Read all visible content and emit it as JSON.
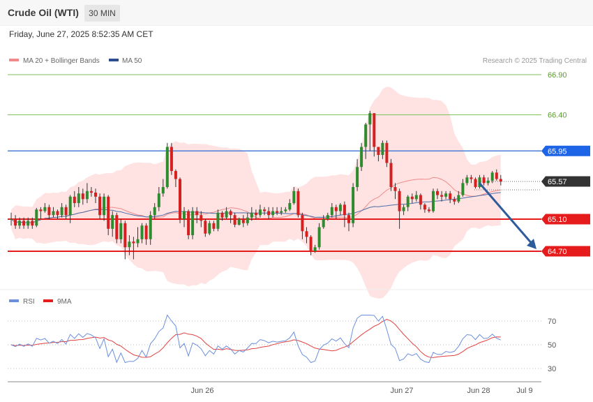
{
  "header": {
    "title": "Crude Oil (WTI)",
    "timeframe": "30 MIN"
  },
  "datetime": "Friday, June 27, 2025 8:52:35 AM CET",
  "legend": {
    "ma20": "MA 20 + Bollinger Bands",
    "ma50": "MA 50",
    "credit": "Research © 2025 Trading Central"
  },
  "rsi_legend": {
    "rsi": "RSI",
    "ma9": "9MA"
  },
  "colors": {
    "green_level": "#7dc35a",
    "blue_level": "#4a7fd8",
    "red_level": "#e61b1b",
    "band_fill": "#ffd9d9",
    "candle_up": "#2e8b2e",
    "candle_down": "#d62020",
    "ma20": "#f08a8a",
    "ma50": "#4a6da8",
    "rsi": "#6a8fdc",
    "rsi_ma": "#e24040",
    "current_price": "#333333",
    "arrow": "#2e5c9a"
  },
  "chart_data": [
    {
      "type": "candlestick",
      "ylim": [
        64.42,
        67.0
      ],
      "levels": [
        {
          "value": 66.9,
          "label": "66.90",
          "kind": "resistance-green"
        },
        {
          "value": 66.4,
          "label": "66.40",
          "kind": "resistance-green"
        },
        {
          "value": 65.95,
          "label": "65.95",
          "kind": "pivot-blue"
        },
        {
          "value": 65.57,
          "label": "65.57",
          "kind": "current-price"
        },
        {
          "value": 65.1,
          "label": "65.10",
          "kind": "support-red"
        },
        {
          "value": 64.7,
          "label": "64.70",
          "kind": "support-red"
        }
      ],
      "forecast_arrow": {
        "from": 65.57,
        "to": 64.7,
        "direction": "down"
      },
      "x_ticks": [
        "Jun 26",
        "Jun 27",
        "Jun 28",
        "Jul 9"
      ],
      "candles": [
        [
          65.1,
          65.1,
          65.18,
          65.02
        ],
        [
          65.1,
          65.02,
          65.15,
          64.98
        ],
        [
          65.02,
          65.08,
          65.12,
          64.98
        ],
        [
          65.08,
          65.02,
          65.12,
          64.98
        ],
        [
          65.02,
          65.08,
          65.12,
          64.98
        ],
        [
          65.08,
          65.02,
          65.12,
          64.98
        ],
        [
          65.02,
          65.22,
          65.24,
          65.0
        ],
        [
          65.22,
          65.2,
          65.25,
          65.1
        ],
        [
          65.2,
          65.25,
          65.3,
          65.18
        ],
        [
          65.25,
          65.15,
          65.28,
          65.1
        ],
        [
          65.15,
          65.2,
          65.25,
          65.12
        ],
        [
          65.2,
          65.15,
          65.22,
          65.1
        ],
        [
          65.15,
          65.25,
          65.3,
          65.12
        ],
        [
          65.25,
          65.15,
          65.28,
          65.1
        ],
        [
          65.15,
          65.38,
          65.4,
          65.05
        ],
        [
          65.38,
          65.3,
          65.45,
          65.25
        ],
        [
          65.3,
          65.42,
          65.5,
          65.25
        ],
        [
          65.42,
          65.35,
          65.48,
          65.28
        ],
        [
          65.35,
          65.45,
          65.55,
          65.3
        ],
        [
          65.45,
          65.43,
          65.5,
          65.38
        ],
        [
          65.43,
          65.38,
          65.48,
          65.3
        ],
        [
          65.38,
          65.15,
          65.42,
          65.1
        ],
        [
          65.15,
          65.38,
          65.42,
          65.08
        ],
        [
          65.38,
          64.98,
          65.4,
          64.9
        ],
        [
          64.98,
          65.15,
          65.2,
          64.88
        ],
        [
          65.15,
          64.85,
          65.18,
          64.8
        ],
        [
          64.85,
          65.05,
          65.1,
          64.8
        ],
        [
          65.05,
          64.75,
          65.08,
          64.6
        ],
        [
          64.75,
          64.82,
          64.9,
          64.65
        ],
        [
          64.82,
          64.8,
          64.88,
          64.6
        ],
        [
          64.8,
          64.85,
          65.0,
          64.75
        ],
        [
          64.85,
          65.02,
          65.05,
          64.8
        ],
        [
          65.02,
          64.85,
          65.05,
          64.78
        ],
        [
          64.85,
          65.15,
          65.2,
          64.78
        ],
        [
          65.15,
          65.25,
          65.3,
          65.1
        ],
        [
          65.25,
          65.42,
          65.5,
          65.2
        ],
        [
          65.42,
          65.5,
          65.6,
          65.38
        ],
        [
          65.5,
          66.0,
          66.05,
          65.48
        ],
        [
          66.0,
          65.7,
          66.05,
          65.65
        ],
        [
          65.7,
          65.6,
          65.72,
          65.5
        ],
        [
          65.6,
          65.1,
          65.62,
          65.05
        ],
        [
          65.1,
          65.2,
          65.25,
          65.0
        ],
        [
          65.2,
          64.9,
          65.22,
          64.85
        ],
        [
          64.9,
          65.2,
          65.25,
          64.85
        ],
        [
          65.2,
          65.15,
          65.25,
          65.05
        ],
        [
          65.15,
          65.08,
          65.2,
          65.0
        ],
        [
          65.08,
          64.92,
          65.1,
          64.88
        ],
        [
          64.92,
          65.05,
          65.08,
          64.9
        ],
        [
          65.05,
          64.98,
          65.08,
          64.95
        ],
        [
          64.98,
          65.18,
          65.22,
          64.95
        ],
        [
          65.18,
          65.12,
          65.2,
          65.08
        ],
        [
          65.12,
          65.2,
          65.25,
          65.1
        ],
        [
          65.2,
          65.15,
          65.22,
          65.05
        ],
        [
          65.15,
          65.03,
          65.18,
          65.0
        ],
        [
          65.03,
          65.1,
          65.12,
          65.02
        ],
        [
          65.1,
          65.05,
          65.15,
          65.0
        ],
        [
          65.05,
          65.12,
          65.18,
          65.02
        ],
        [
          65.12,
          65.18,
          65.25,
          65.08
        ],
        [
          65.18,
          65.15,
          65.22,
          65.1
        ],
        [
          65.15,
          65.22,
          65.28,
          65.12
        ],
        [
          65.22,
          65.2,
          65.25,
          65.15
        ],
        [
          65.2,
          65.15,
          65.25,
          65.1
        ],
        [
          65.15,
          65.2,
          65.25,
          65.12
        ],
        [
          65.2,
          65.18,
          65.25,
          65.15
        ],
        [
          65.18,
          65.2,
          65.25,
          65.15
        ],
        [
          65.2,
          65.22,
          65.25,
          65.18
        ],
        [
          65.22,
          65.3,
          65.35,
          65.2
        ],
        [
          65.3,
          65.45,
          65.5,
          65.28
        ],
        [
          65.45,
          65.15,
          65.48,
          65.12
        ],
        [
          65.15,
          64.95,
          65.18,
          64.85
        ],
        [
          64.95,
          64.88,
          65.0,
          64.8
        ],
        [
          64.88,
          64.7,
          64.9,
          64.65
        ],
        [
          64.7,
          64.75,
          64.78,
          64.68
        ],
        [
          64.75,
          65.0,
          65.05,
          64.72
        ],
        [
          65.0,
          65.1,
          65.15,
          64.98
        ],
        [
          65.1,
          65.15,
          65.18,
          65.08
        ],
        [
          65.15,
          65.25,
          65.3,
          65.12
        ],
        [
          65.25,
          65.2,
          65.28,
          65.1
        ],
        [
          65.2,
          65.28,
          65.3,
          65.15
        ],
        [
          65.28,
          65.15,
          65.32,
          65.0
        ],
        [
          65.15,
          65.05,
          65.18,
          64.95
        ],
        [
          65.05,
          65.5,
          65.55,
          65.0
        ],
        [
          65.5,
          65.75,
          65.85,
          65.45
        ],
        [
          65.75,
          66.0,
          66.05,
          65.7
        ],
        [
          66.0,
          66.28,
          66.3,
          65.85
        ],
        [
          66.28,
          66.42,
          66.45,
          65.95
        ],
        [
          66.42,
          66.0,
          66.42,
          65.88
        ],
        [
          66.0,
          65.9,
          65.95,
          65.82
        ],
        [
          65.9,
          66.05,
          66.08,
          65.85
        ],
        [
          66.05,
          65.8,
          66.08,
          65.75
        ],
        [
          65.8,
          65.5,
          65.85,
          65.45
        ],
        [
          65.5,
          65.45,
          65.55,
          65.35
        ],
        [
          65.45,
          65.2,
          65.48,
          64.98
        ],
        [
          65.2,
          65.25,
          65.28,
          65.15
        ],
        [
          65.25,
          65.38,
          65.4,
          65.2
        ],
        [
          65.38,
          65.35,
          65.42,
          65.3
        ],
        [
          65.35,
          65.4,
          65.45,
          65.32
        ],
        [
          65.4,
          65.28,
          65.42,
          65.22
        ],
        [
          65.28,
          65.22,
          65.3,
          65.18
        ],
        [
          65.22,
          65.2,
          65.25,
          65.18
        ],
        [
          65.2,
          65.45,
          65.48,
          65.18
        ],
        [
          65.45,
          65.4,
          65.48,
          65.35
        ],
        [
          65.4,
          65.38,
          65.45,
          65.32
        ],
        [
          65.38,
          65.42,
          65.45,
          65.35
        ],
        [
          65.42,
          65.35,
          65.45,
          65.3
        ],
        [
          65.35,
          65.32,
          65.38,
          65.28
        ],
        [
          65.32,
          65.4,
          65.45,
          65.3
        ],
        [
          65.4,
          65.55,
          65.6,
          65.38
        ],
        [
          65.55,
          65.62,
          65.65,
          65.52
        ],
        [
          65.62,
          65.6,
          65.65,
          65.55
        ],
        [
          65.6,
          65.5,
          65.62,
          65.48
        ],
        [
          65.5,
          65.62,
          65.65,
          65.48
        ],
        [
          65.62,
          65.55,
          65.65,
          65.52
        ],
        [
          65.55,
          65.58,
          65.62,
          65.52
        ],
        [
          65.58,
          65.68,
          65.7,
          65.55
        ],
        [
          65.68,
          65.6,
          65.72,
          65.58
        ],
        [
          65.6,
          65.57,
          65.65,
          65.52
        ]
      ]
    },
    {
      "type": "line",
      "title": "RSI",
      "yticks": [
        70,
        50,
        30
      ],
      "ylim": [
        20,
        80
      ]
    }
  ]
}
